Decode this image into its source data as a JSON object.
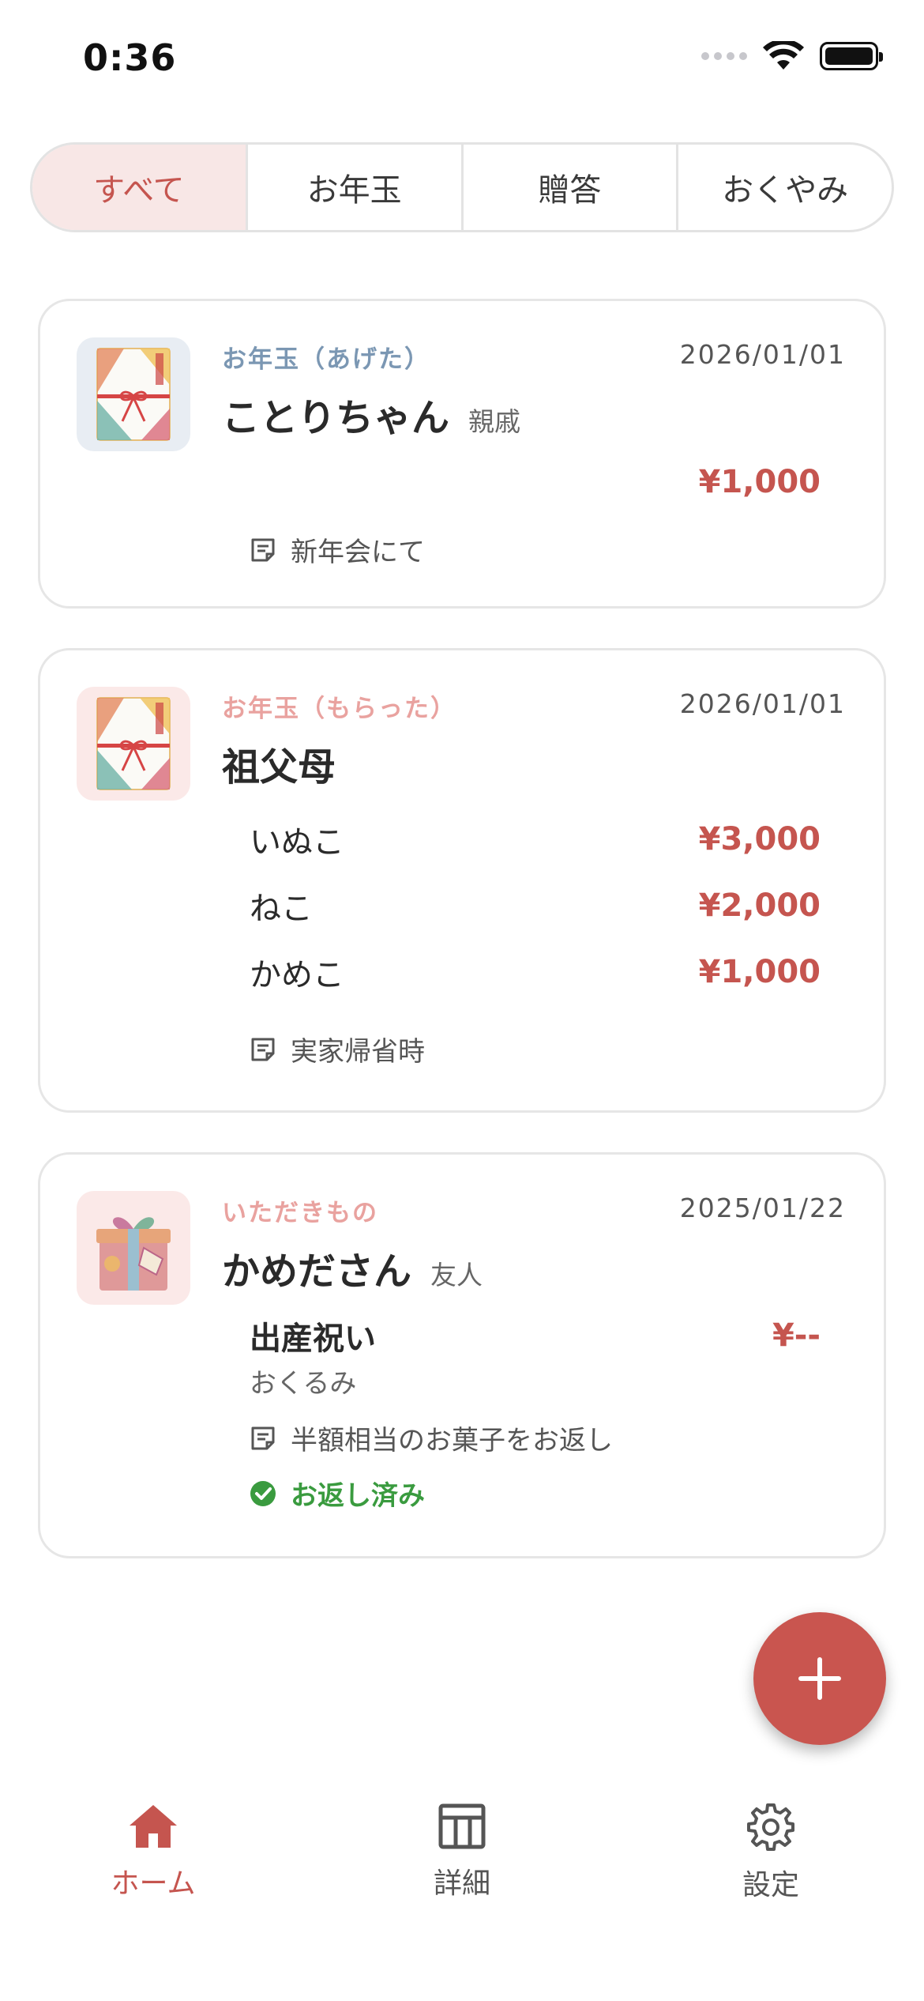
{
  "status_bar": {
    "time": "0:36",
    "icons": [
      "cellular-icon",
      "wifi-icon",
      "battery-icon"
    ]
  },
  "tabs": [
    {
      "label": "すべて",
      "active": true
    },
    {
      "label": "お年玉",
      "active": false
    },
    {
      "label": "贈答",
      "active": false
    },
    {
      "label": "おくやみ",
      "active": false
    }
  ],
  "cards": [
    {
      "category": "お年玉（あげた）",
      "date": "2026/01/01",
      "name": "ことりちゃん",
      "relation": "親戚",
      "amount": "¥1,000",
      "note": "新年会にて",
      "thumb_icon": "otoshidama-envelope-icon"
    },
    {
      "category": "お年玉（もらった）",
      "date": "2026/01/01",
      "name": "祖父母",
      "items": [
        {
          "label": "いぬこ",
          "amount": "¥3,000"
        },
        {
          "label": "ねこ",
          "amount": "¥2,000"
        },
        {
          "label": "かめこ",
          "amount": "¥1,000"
        }
      ],
      "note": "実家帰省時",
      "thumb_icon": "otoshidama-envelope-icon"
    },
    {
      "category": "いただきもの",
      "date": "2025/01/22",
      "name": "かめださん",
      "relation": "友人",
      "occasion": "出産祝い",
      "gift": "おくるみ",
      "amount": "¥--",
      "note": "半額相当のお菓子をお返し",
      "status": "お返し済み",
      "thumb_icon": "gift-box-icon"
    }
  ],
  "fab": {
    "icon": "plus-icon"
  },
  "bottom_nav": [
    {
      "label": "ホーム",
      "icon": "home-icon",
      "active": true
    },
    {
      "label": "詳細",
      "icon": "table-icon",
      "active": false
    },
    {
      "label": "設定",
      "icon": "gear-icon",
      "active": false
    }
  ],
  "colors": {
    "accent": "#c5554f",
    "tab_active_bg": "#f8e7e6",
    "given_category": "#7b97b3",
    "received_category": "#e9a29f",
    "done_green": "#3a9b3f"
  }
}
